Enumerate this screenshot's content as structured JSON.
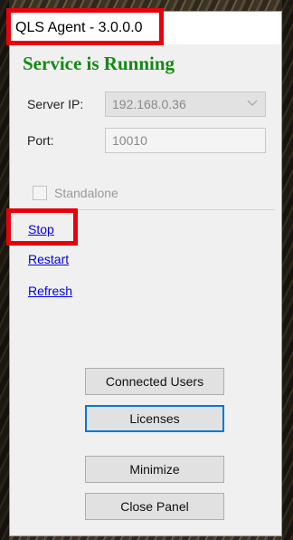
{
  "window": {
    "title": "QLS Agent - 3.0.0.0"
  },
  "status": {
    "text": "Service is Running",
    "color": "#138a13"
  },
  "settings": {
    "server_ip_label": "Server IP:",
    "server_ip_value": "192.168.0.36",
    "port_label": "Port:",
    "port_value": "10010",
    "standalone_label": "Standalone",
    "standalone_checked": false
  },
  "links": {
    "stop": "Stop",
    "restart": "Restart",
    "refresh": "Refresh"
  },
  "buttons": {
    "connected_users": "Connected Users",
    "licenses": "Licenses",
    "minimize": "Minimize",
    "close_panel": "Close Panel"
  },
  "annotations": {
    "highlight_color": "#e8000b",
    "highlighted": [
      "window-title",
      "stop-link"
    ]
  },
  "icons": {
    "server_ip_dropdown": "chevron-down-icon"
  }
}
